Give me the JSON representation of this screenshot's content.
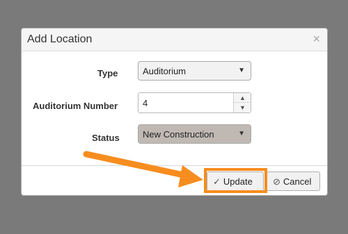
{
  "dialog": {
    "title": "Add Location",
    "close_glyph": "×",
    "fields": {
      "type_label": "Type",
      "type_value": "Auditorium",
      "auditorium_number_label": "Auditorium Number",
      "auditorium_number_value": "4",
      "status_label": "Status",
      "status_value": "New Construction"
    },
    "buttons": {
      "update": "Update",
      "cancel": "Cancel"
    }
  },
  "icons": {
    "dropdown": "chevron-down-icon",
    "spin_up": "chevron-up-icon",
    "spin_down": "chevron-down-icon",
    "update": "checkmark-icon",
    "cancel": "prohibited-icon"
  },
  "colors": {
    "overlay": "#7a7a7a",
    "dialog_bg": "#ffffff",
    "status_select_bg": "#c0b9b3",
    "annotation": "#f78d1e"
  }
}
